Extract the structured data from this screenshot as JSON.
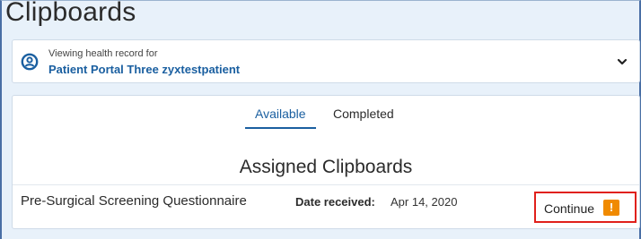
{
  "page": {
    "title": "Clipboards"
  },
  "record": {
    "caption": "Viewing health record for",
    "patient_name": "Patient Portal Three zyxtestpatient"
  },
  "tabs": [
    {
      "label": "Available",
      "active": true
    },
    {
      "label": "Completed",
      "active": false
    }
  ],
  "section": {
    "title": "Assigned Clipboards"
  },
  "clipboards": [
    {
      "name": "Pre-Surgical Screening Questionnaire",
      "date_label": "Date received:",
      "date_value": "Apr 14, 2020",
      "action_label": "Continue",
      "alert_symbol": "!"
    }
  ],
  "colors": {
    "accent": "#1a5fa0",
    "alert": "#f08a00",
    "highlight_border": "#e0201b"
  },
  "icons": {
    "record": "person-circle-icon",
    "expand": "chevron-down-icon",
    "alert": "exclamation-icon"
  }
}
